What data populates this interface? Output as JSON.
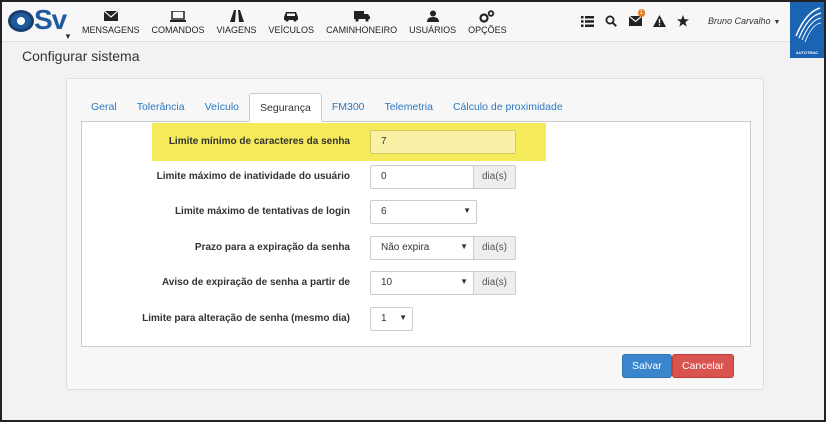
{
  "app": {
    "logo_text": "Sv"
  },
  "nav": [
    {
      "label": "MENSAGENS",
      "icon": "envelope-icon"
    },
    {
      "label": "COMANDOS",
      "icon": "laptop-icon"
    },
    {
      "label": "VIAGENS",
      "icon": "road-icon"
    },
    {
      "label": "VEÍCULOS",
      "icon": "car-icon"
    },
    {
      "label": "CAMINHONEIRO",
      "icon": "truck-icon"
    },
    {
      "label": "USUÁRIOS",
      "icon": "user-icon"
    },
    {
      "label": "OPÇÕES",
      "icon": "gears-icon"
    }
  ],
  "tools": {
    "messages_badge": "1"
  },
  "user": {
    "name": "Bruno Carvalho"
  },
  "brand": {
    "text": "AUTOTRAC"
  },
  "page": {
    "title": "Configurar sistema"
  },
  "tabs": [
    "Geral",
    "Tolerância",
    "Veículo",
    "Segurança",
    "FM300",
    "Telemetria",
    "Cálculo de proximidade"
  ],
  "active_tab": "Segurança",
  "form": {
    "min_chars_label": "Limite mínimo de caracteres da senha",
    "min_chars_value": "7",
    "inactivity_label": "Limite máximo de inatividade do usuário",
    "inactivity_value": "0",
    "inactivity_unit": "dia(s)",
    "login_attempts_label": "Limite máximo de tentativas de login",
    "login_attempts_value": "6",
    "expiration_label": "Prazo para a expiração da senha",
    "expiration_value": "Não expira",
    "expiration_unit": "dia(s)",
    "warning_label": "Aviso de expiração de senha a partir de",
    "warning_value": "10",
    "warning_unit": "dia(s)",
    "change_limit_label": "Limite para alteração de senha (mesmo dia)",
    "change_limit_value": "1"
  },
  "buttons": {
    "save": "Salvar",
    "cancel": "Cancelar"
  },
  "colors": {
    "highlight": "#f5ea5a",
    "primary": "#3a86cc",
    "danger": "#d9534f",
    "brand": "#1b63b3",
    "link": "#2a78c2"
  }
}
